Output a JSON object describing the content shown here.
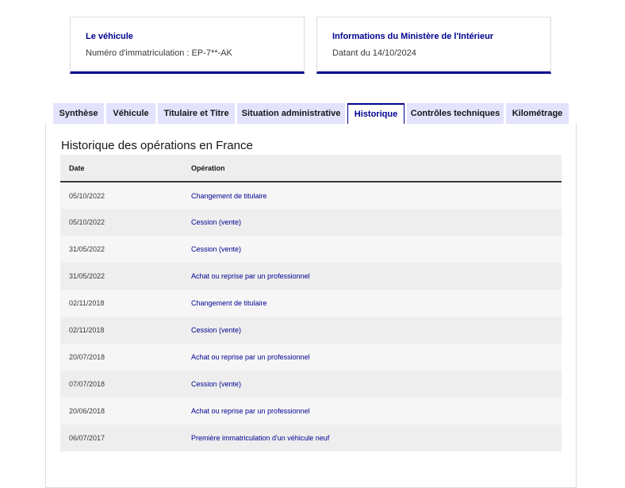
{
  "cards": [
    {
      "title": "Le véhicule",
      "text": "Numéro d'immatriculation : EP-7**-AK"
    },
    {
      "title": "Informations du Ministère de l'Intérieur",
      "text": "Datant du 14/10/2024"
    }
  ],
  "tabs": [
    {
      "label": "Synthèse",
      "active": false
    },
    {
      "label": "Véhicule",
      "active": false
    },
    {
      "label": "Titulaire et Titre",
      "active": false
    },
    {
      "label": "Situation administrative",
      "active": false
    },
    {
      "label": "Historique",
      "active": true
    },
    {
      "label": "Contrôles techniques",
      "active": false
    },
    {
      "label": "Kilométrage",
      "active": false
    }
  ],
  "history": {
    "title": "Historique des opérations en France",
    "headers": {
      "date": "Date",
      "operation": "Opération"
    },
    "rows": [
      {
        "date": "05/10/2022",
        "operation": "Changement de titulaire"
      },
      {
        "date": "05/10/2022",
        "operation": "Cession (vente)"
      },
      {
        "date": "31/05/2022",
        "operation": "Cession (vente)"
      },
      {
        "date": "31/05/2022",
        "operation": "Achat ou reprise par un professionnel"
      },
      {
        "date": "02/11/2018",
        "operation": "Changement de titulaire"
      },
      {
        "date": "02/11/2018",
        "operation": "Cession (vente)"
      },
      {
        "date": "20/07/2018",
        "operation": "Achat ou reprise par un professionnel"
      },
      {
        "date": "07/07/2018",
        "operation": "Cession (vente)"
      },
      {
        "date": "20/06/2018",
        "operation": "Achat ou reprise par un professionnel"
      },
      {
        "date": "06/07/2017",
        "operation": "Première immatriculation d'un véhicule neuf"
      }
    ]
  },
  "colors": {
    "primary": "#000091",
    "tab_background": "#e3e3fd",
    "row_stripe": "#eeeeee"
  }
}
